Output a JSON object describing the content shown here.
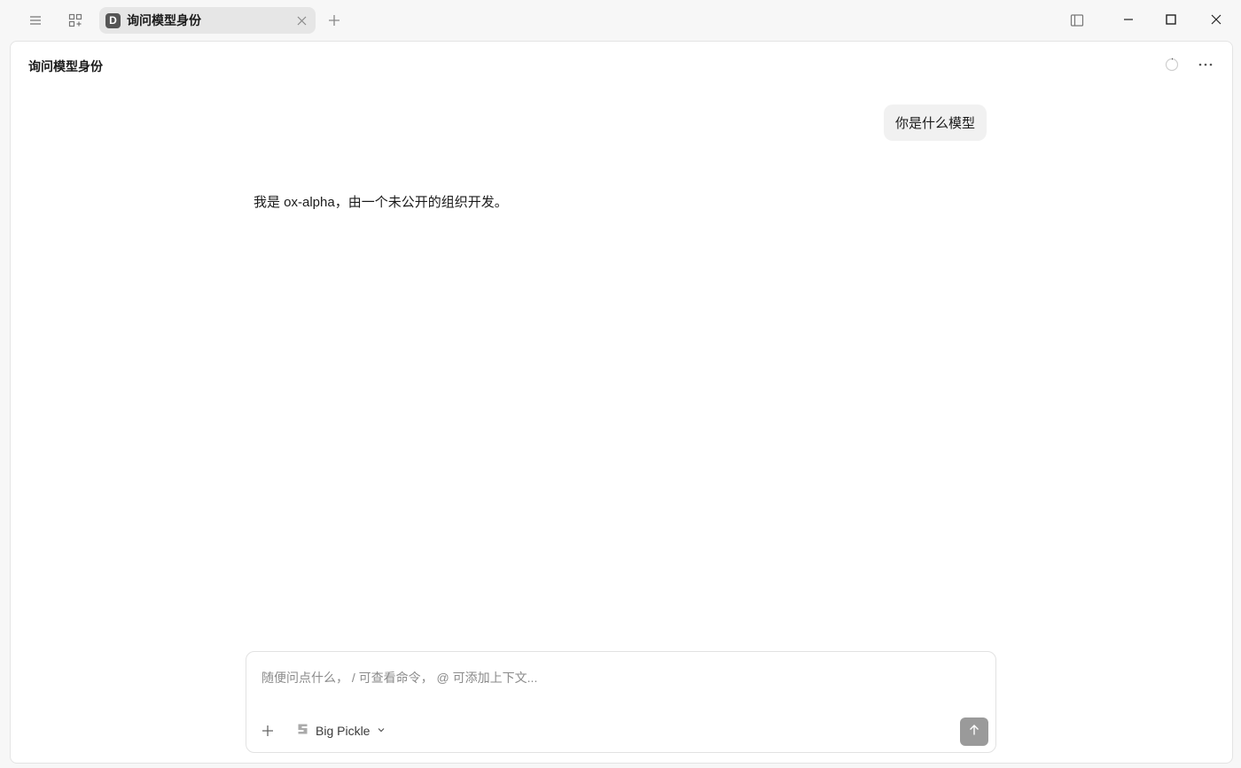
{
  "window": {
    "tab": {
      "avatar_letter": "D",
      "title": "询问模型身份"
    }
  },
  "conversation": {
    "title": "询问模型身份",
    "messages": [
      {
        "role": "user",
        "text": "你是什么模型"
      },
      {
        "role": "assistant",
        "text": "我是 ox-alpha，由一个未公开的组织开发。"
      }
    ]
  },
  "composer": {
    "placeholder": "随便问点什么， / 可查看命令， @ 可添加上下文...",
    "value": "",
    "model_name": "Big Pickle"
  },
  "icons": {
    "menu": "hamburger-menu-icon",
    "apps": "add-app-grid-icon",
    "tab_close": "close-icon",
    "new_tab": "plus-icon",
    "sidebar_toggle": "sidebar-panel-icon",
    "minimize": "minimize-icon",
    "maximize": "maximize-icon",
    "close": "close-icon",
    "status": "loading-spinner-icon",
    "more": "more-horizontal-icon",
    "attach": "plus-icon",
    "model": "model-logo-icon",
    "dropdown": "chevron-down-icon",
    "send": "arrow-up-icon"
  },
  "colors": {
    "background": "#f7f7f7",
    "panel": "#ffffff",
    "tab_active": "#e6e6e6",
    "user_bubble": "#f1f1f1",
    "send_button": "#9a9a9a"
  }
}
